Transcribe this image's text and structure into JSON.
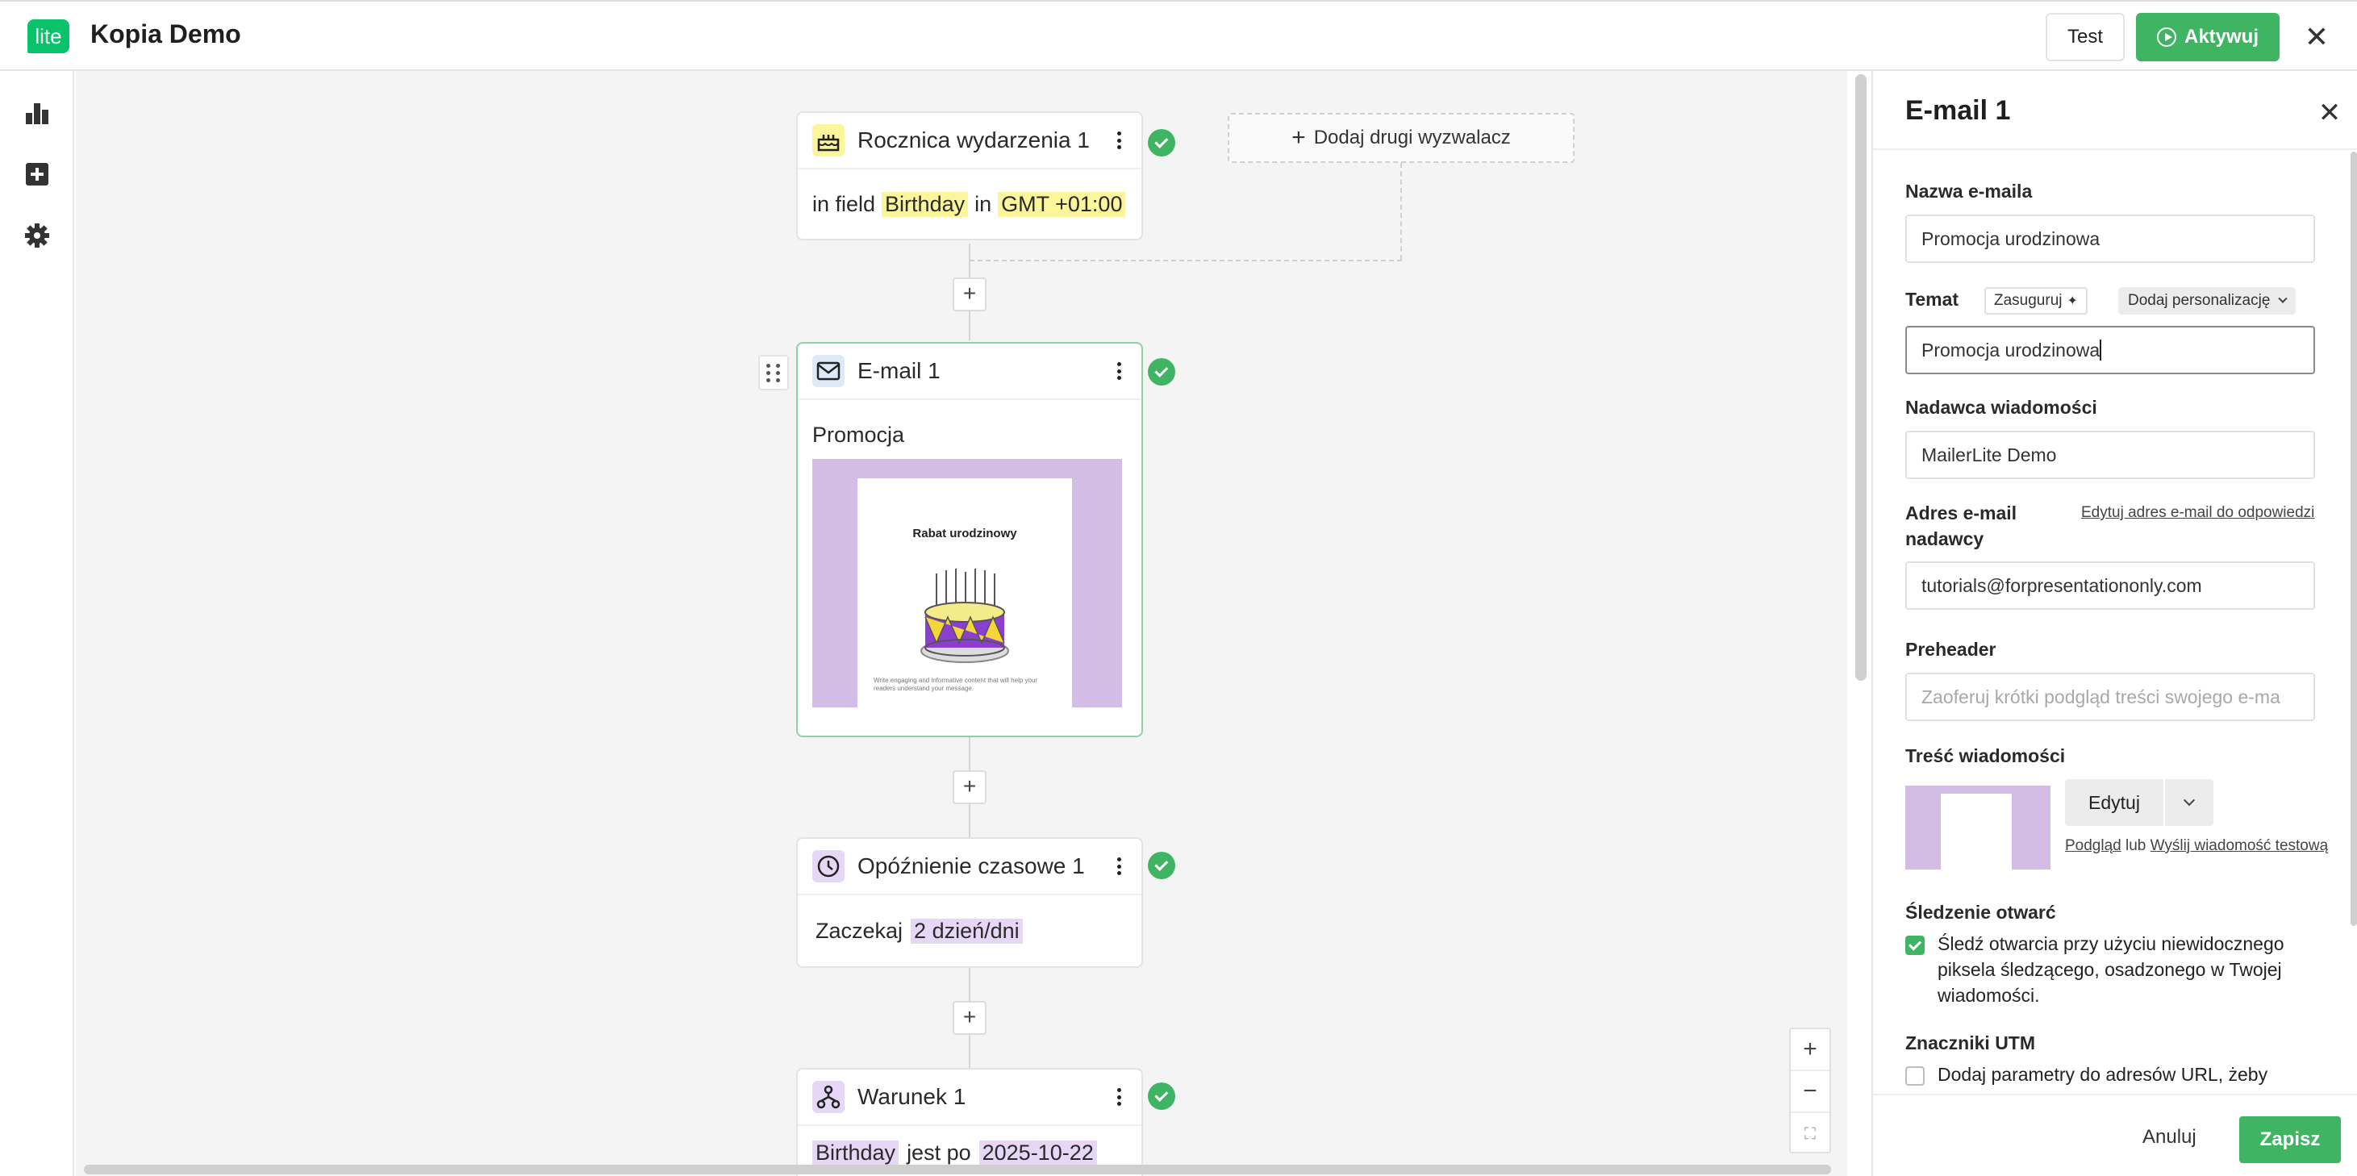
{
  "header": {
    "logo_text": "lite",
    "title": "Kopia Demo",
    "test_label": "Test",
    "activate_label": "Aktywuj"
  },
  "sidebar": {
    "items": [
      {
        "icon": "bar-chart-icon"
      },
      {
        "icon": "add-box-icon"
      },
      {
        "icon": "gear-icon"
      }
    ]
  },
  "workflow": {
    "add_trigger_label": "Dodaj drugi wyzwalacz",
    "trigger": {
      "title": "Rocznica wydarzenia 1",
      "text_in_field": "in field",
      "field": "Birthday",
      "text_in": "in",
      "timezone": "GMT +01:00"
    },
    "email": {
      "title": "E-mail 1",
      "subject": "Promocja",
      "preview_heading": "Rabat urodzinowy",
      "preview_body": "Write engaging and informative content that will help your readers understand your message."
    },
    "delay": {
      "title": "Opóźnienie czasowe 1",
      "text": "Zaczekaj",
      "value": "2 dzień/dni"
    },
    "condition": {
      "title": "Warunek 1",
      "field": "Birthday",
      "text": "jest po",
      "value": "2025-10-22"
    },
    "plus": "+",
    "zoom_in": "+",
    "zoom_out": "−",
    "fit": "⛶"
  },
  "panel": {
    "title": "E-mail 1",
    "email_name_label": "Nazwa e-maila",
    "email_name_value": "Promocja urodzinowa",
    "subject_label": "Temat",
    "suggest_label": "Zasuguruj",
    "personalize_label": "Dodaj personalizację",
    "subject_value": "Promocja urodzinowa",
    "sender_label": "Nadawca wiadomości",
    "sender_value": "MailerLite Demo",
    "sender_email_label": "Adres e-mail nadawcy",
    "edit_reply_link": "Edytuj adres e-mail do odpowiedzi",
    "sender_email_value": "tutorials@forpresentationonly.com",
    "preheader_label": "Preheader",
    "preheader_placeholder": "Zaoferuj krótki podgląd treści swojego e-ma",
    "content_label": "Treść wiadomości",
    "edit_button": "Edytuj",
    "preview_link": "Podgląd",
    "or_text": "lub",
    "send_test_link": "Wyślij wiadomość testową",
    "open_tracking_label": "Śledzenie otwarć",
    "open_tracking_text": "Śledź otwarcia przy użyciu niewidocznego piksela śledzącego, osadzonego w Twojej wiadomości.",
    "open_tracking_checked": true,
    "utm_label": "Znaczniki UTM",
    "utm_text": "Dodaj parametry do adresów URL, żeby",
    "utm_checked": false,
    "cancel_label": "Anuluj",
    "save_label": "Zapisz"
  },
  "colors": {
    "brand_green": "#3fb463",
    "highlight_yellow": "#fbf59b",
    "highlight_purple": "#e6d7f6",
    "email_preview_bg": "#d3bde6"
  }
}
